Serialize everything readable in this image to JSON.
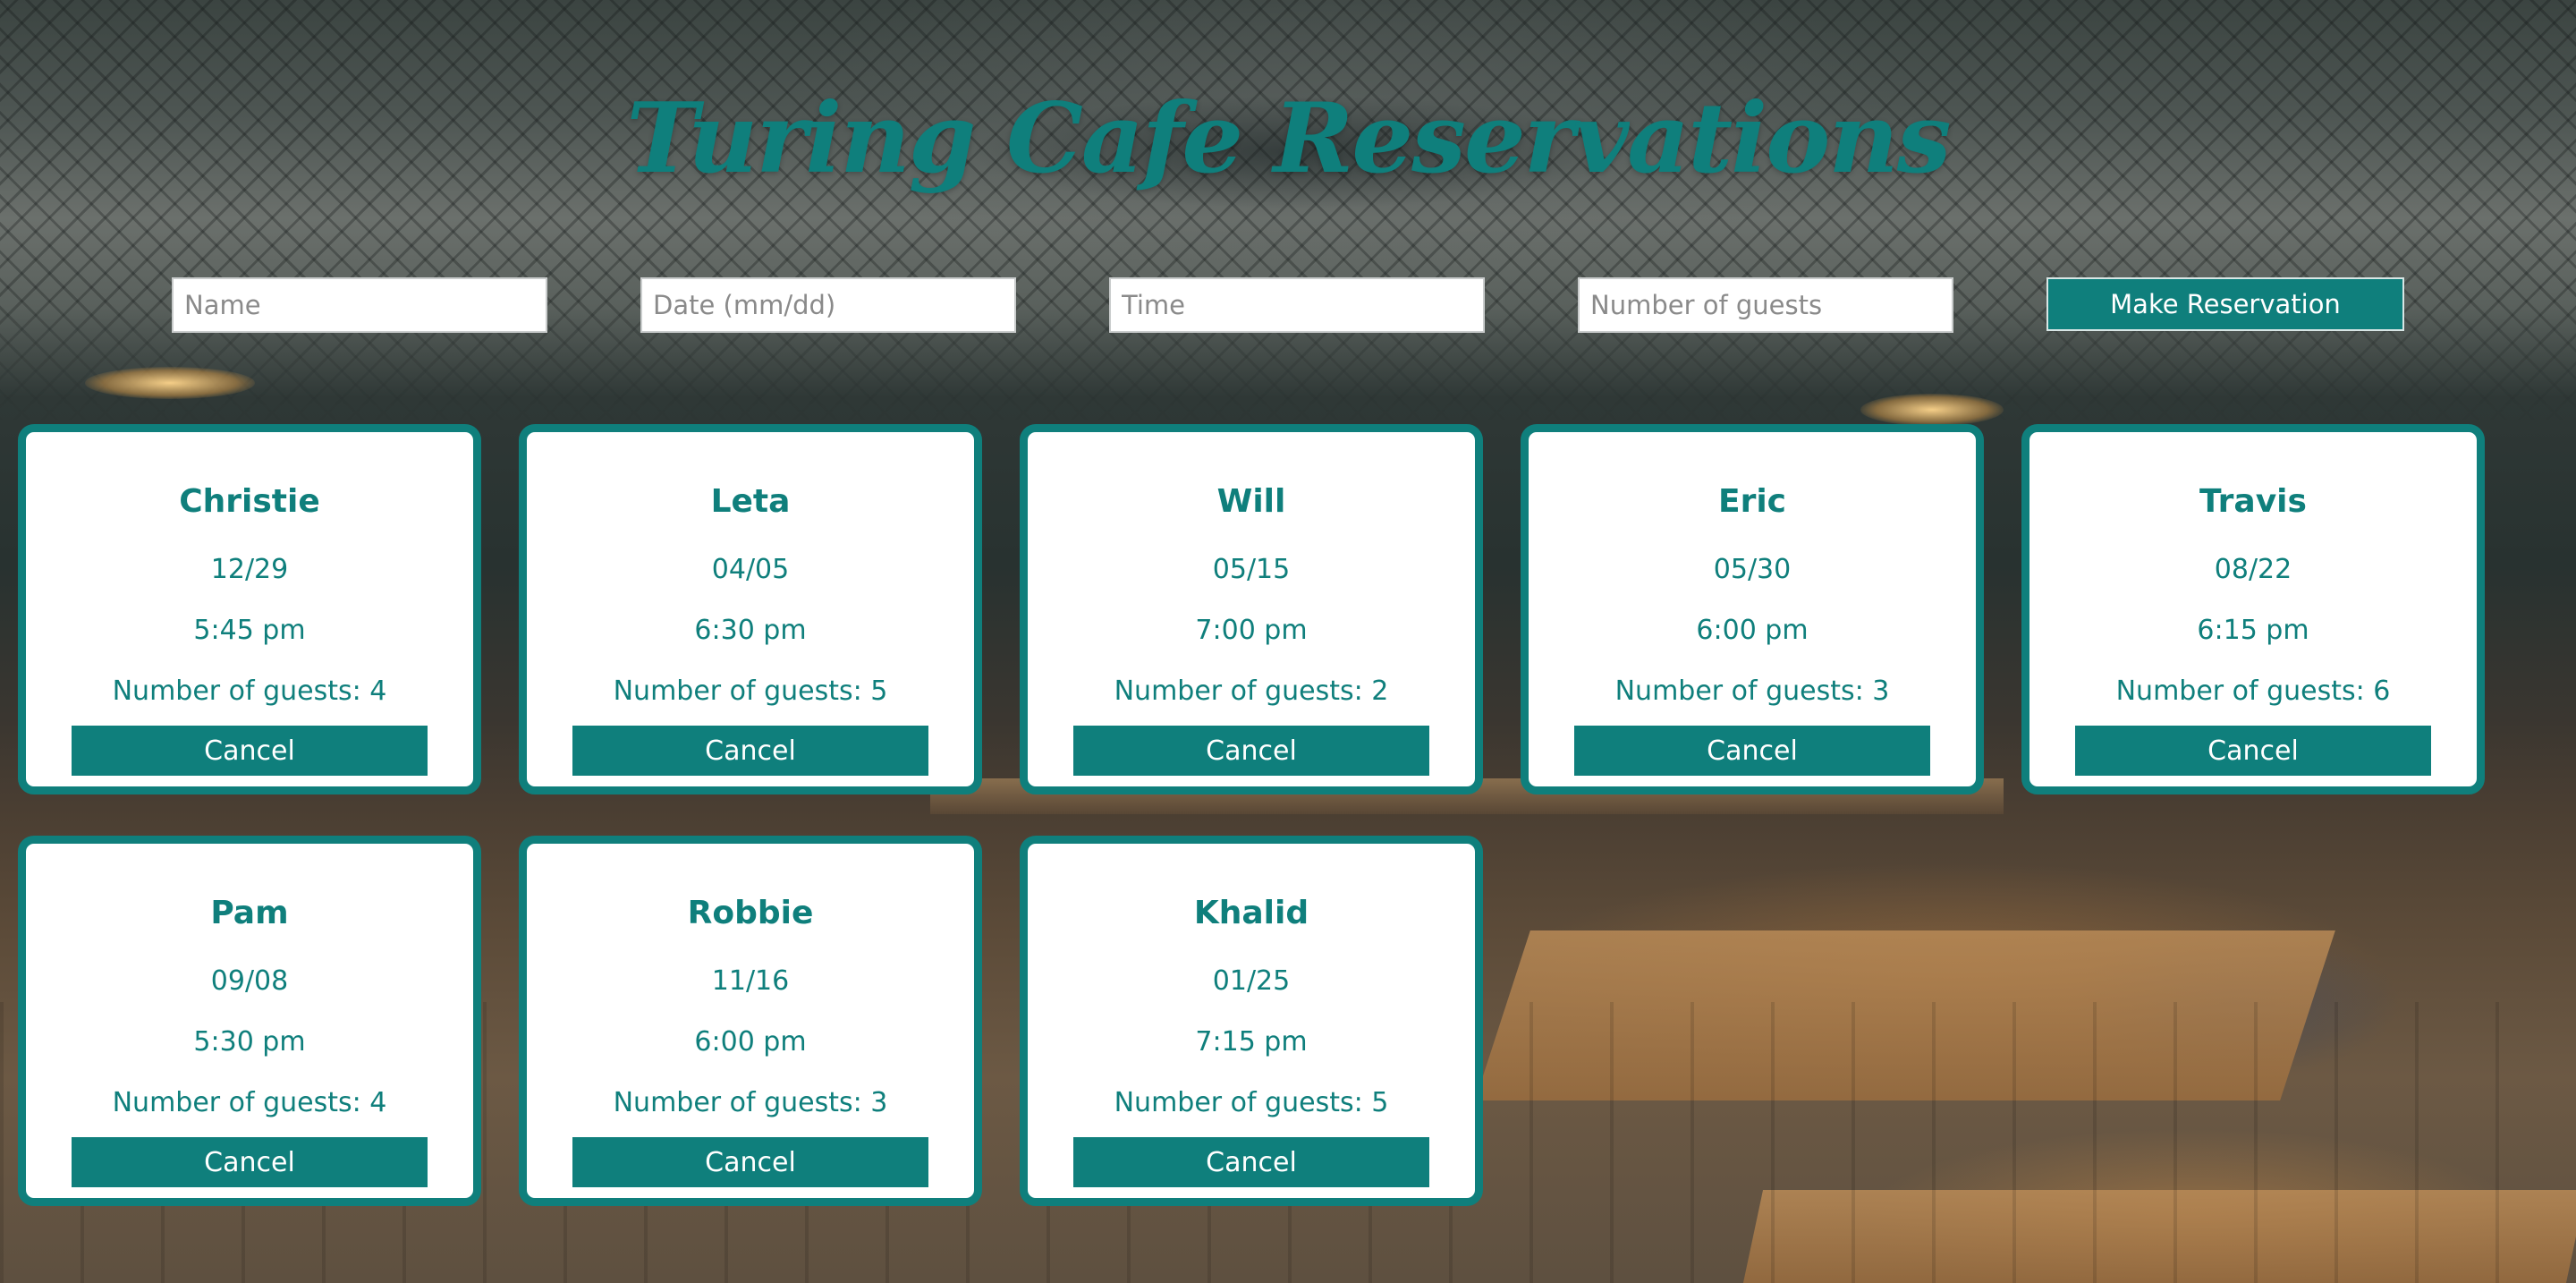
{
  "header": {
    "title": "Turing Cafe Reservations"
  },
  "form": {
    "name_placeholder": "Name",
    "date_placeholder": "Date (mm/dd)",
    "time_placeholder": "Time",
    "guests_placeholder": "Number of guests",
    "submit_label": "Make Reservation"
  },
  "colors": {
    "accent": "#0f7f7c",
    "card_background": "#ffffff"
  },
  "reservations": [
    {
      "name": "Christie",
      "date": "12/29",
      "time": "5:45 pm",
      "guests_label": "Number of guests: 4",
      "cancel_label": "Cancel"
    },
    {
      "name": "Leta",
      "date": "04/05",
      "time": "6:30 pm",
      "guests_label": "Number of guests: 5",
      "cancel_label": "Cancel"
    },
    {
      "name": "Will",
      "date": "05/15",
      "time": "7:00 pm",
      "guests_label": "Number of guests: 2",
      "cancel_label": "Cancel"
    },
    {
      "name": "Eric",
      "date": "05/30",
      "time": "6:00 pm",
      "guests_label": "Number of guests: 3",
      "cancel_label": "Cancel"
    },
    {
      "name": "Travis",
      "date": "08/22",
      "time": "6:15 pm",
      "guests_label": "Number of guests: 6",
      "cancel_label": "Cancel"
    },
    {
      "name": "Pam",
      "date": "09/08",
      "time": "5:30 pm",
      "guests_label": "Number of guests: 4",
      "cancel_label": "Cancel"
    },
    {
      "name": "Robbie",
      "date": "11/16",
      "time": "6:00 pm",
      "guests_label": "Number of guests: 3",
      "cancel_label": "Cancel"
    },
    {
      "name": "Khalid",
      "date": "01/25",
      "time": "7:15 pm",
      "guests_label": "Number of guests: 5",
      "cancel_label": "Cancel"
    }
  ]
}
